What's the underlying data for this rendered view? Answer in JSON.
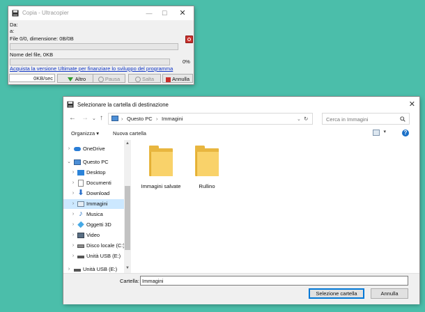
{
  "ultracopier": {
    "title": "Copia - Ultracopier",
    "from_label": "Da:",
    "to_label": "a:",
    "file_info": "File 0/0, dimensione: 0B/0B",
    "filename_info": "Nome del file, 0KB",
    "percent": "0%",
    "overall_progress": 0,
    "file_progress": 0,
    "ultimate_link": "Acquista la versione Ultimate per finanziare lo sviluppo del programma",
    "speed": "0KB/sec",
    "buttons": {
      "more": "Altro",
      "pause": "Pausa",
      "skip": "Salta",
      "cancel": "Annulla"
    },
    "colors": {
      "accent_red": "#c9302c",
      "link": "#0f35c5"
    }
  },
  "dialog": {
    "title": "Selezionare la cartella di destinazione",
    "address": {
      "crumbs": [
        "Questo PC",
        "Immagini"
      ]
    },
    "search": {
      "placeholder": "Cerca in Immagini"
    },
    "toolbar": {
      "organize": "Organizza",
      "new_folder": "Nuova cartella"
    },
    "nav_items": [
      {
        "label": "OneDrive",
        "icon": "cloud-icon"
      },
      {
        "label": "Questo PC",
        "icon": "computer-icon"
      },
      {
        "label": "Desktop",
        "icon": "desktop-folder-icon"
      },
      {
        "label": "Documenti",
        "icon": "documents-icon"
      },
      {
        "label": "Download",
        "icon": "download-icon"
      },
      {
        "label": "Immagini",
        "icon": "pictures-icon",
        "selected": true
      },
      {
        "label": "Musica",
        "icon": "music-icon"
      },
      {
        "label": "Oggetti 3D",
        "icon": "3d-objects-icon"
      },
      {
        "label": "Video",
        "icon": "video-icon"
      },
      {
        "label": "Disco locale (C:)",
        "icon": "drive-icon"
      },
      {
        "label": "Unità USB (E:)",
        "icon": "usb-drive-icon"
      },
      {
        "label": "Unità USB (E:)",
        "icon": "usb-drive-icon"
      }
    ],
    "folders": [
      {
        "label": "Immagini salvate"
      },
      {
        "label": "Rullino"
      }
    ],
    "folder_label": "Cartella:",
    "folder_value": "Immagini",
    "buttons": {
      "select": "Selezione cartella",
      "cancel": "Annulla"
    },
    "colors": {
      "folder": "#f9d26a",
      "selection": "#cce8ff",
      "primary_border": "#0078d7"
    }
  }
}
